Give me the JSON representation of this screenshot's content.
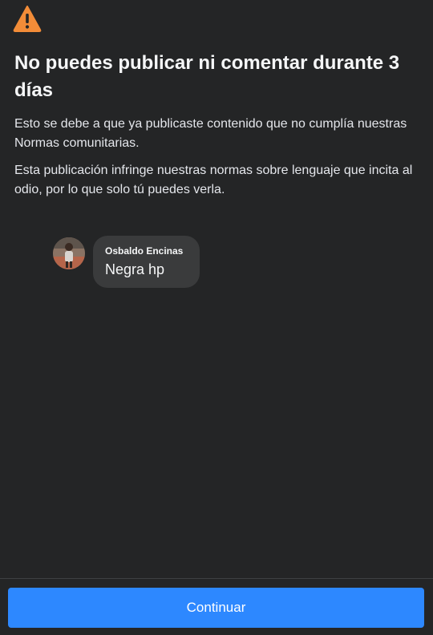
{
  "header": {
    "icon": "warning-triangle-icon",
    "icon_color": "#f28c38",
    "title": "No puedes publicar ni comentar durante 3 días"
  },
  "body": {
    "paragraph_1": "Esto se debe a que ya publicaste contenido que no cumplía nuestras Normas comunitarias.",
    "paragraph_2": "Esta publicación infringe nuestras normas sobre lenguaje que incita al odio, por lo que solo tú puedes verla."
  },
  "comment": {
    "avatar": "user-avatar-photo",
    "author": "Osbaldo Encinas",
    "text": "Negra hp"
  },
  "footer": {
    "continue_label": "Continuar",
    "accent_color": "#2d88ff"
  },
  "colors": {
    "background": "#242526",
    "bubble": "#3a3b3c"
  }
}
